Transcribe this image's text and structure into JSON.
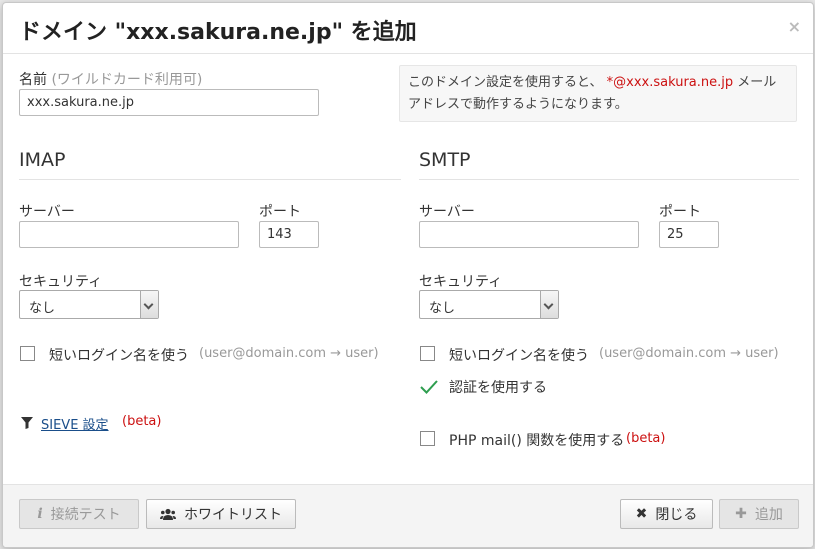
{
  "dialog": {
    "title": "ドメイン \"xxx.sakura.ne.jp\" を追加",
    "close_glyph": "×"
  },
  "name_field": {
    "label": "名前",
    "hint": "(ワイルドカード利用可)",
    "value": "xxx.sakura.ne.jp"
  },
  "info_note": {
    "text_before": "このドメイン設定を使用すると、",
    "highlight": "*@xxx.sakura.ne.jp",
    "text_after": "メールアドレスで動作するようになります。",
    "highlight_color": "#cc1111"
  },
  "imap": {
    "title": "IMAP",
    "server_label": "サーバー",
    "server_value": "",
    "port_label": "ポート",
    "port_value": "143",
    "security_label": "セキュリティ",
    "security_value": "なし",
    "short_login_label": "短いログイン名を使う",
    "short_login_hint": "(user@domain.com → user)",
    "sieve_link": "SIEVE 設定",
    "sieve_beta": "(beta)"
  },
  "smtp": {
    "title": "SMTP",
    "server_label": "サーバー",
    "server_value": "",
    "port_label": "ポート",
    "port_value": "25",
    "security_label": "セキュリティ",
    "security_value": "なし",
    "short_login_label": "短いログイン名を使う",
    "short_login_hint": "(user@domain.com → user)",
    "auth_label": "認証を使用する",
    "auth_checked": true,
    "php_mail_label": "PHP mail() 関数を使用する",
    "php_mail_beta": "(beta)"
  },
  "footer": {
    "test_label": "接続テスト",
    "whitelist_label": "ホワイトリスト",
    "close_label": "閉じる",
    "add_label": "追加"
  },
  "colors": {
    "check_green": "#2e9e4f",
    "beta_red": "#cc1111",
    "link_blue": "#1a4e8a"
  }
}
